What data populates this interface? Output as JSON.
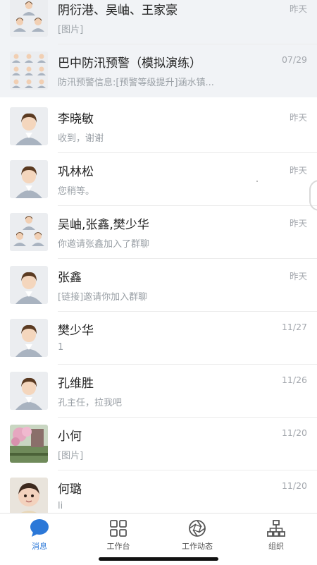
{
  "conversations": [
    {
      "name": "阴衍港、吴岫、王家豪",
      "preview": "[图片]",
      "time": "昨天",
      "avatar": "group-4",
      "pinned": true
    },
    {
      "name": "巴中防汛预警（模拟演练）",
      "preview": "防汛预警信息:[预警等级提升]涵水镇...",
      "time": "07/29",
      "avatar": "group-9",
      "pinned": true
    },
    {
      "name": "李晓敏",
      "preview": "收到，谢谢",
      "time": "昨天",
      "avatar": "person",
      "pinned": false
    },
    {
      "name": "巩林松",
      "preview": "您稍等。",
      "time": "昨天",
      "avatar": "person",
      "pinned": false
    },
    {
      "name": "吴岫,张鑫,樊少华",
      "preview": "你邀请张鑫加入了群聊",
      "time": "昨天",
      "avatar": "group-3",
      "pinned": false
    },
    {
      "name": "张鑫",
      "preview": "[链接]邀请你加入群聊",
      "time": "昨天",
      "avatar": "person",
      "pinned": false
    },
    {
      "name": "樊少华",
      "preview": "1",
      "time": "11/27",
      "avatar": "person",
      "pinned": false
    },
    {
      "name": "孔维胜",
      "preview": "孔主任，拉我吧",
      "time": "11/26",
      "avatar": "person",
      "pinned": false
    },
    {
      "name": "小何",
      "preview": "[图片]",
      "time": "11/20",
      "avatar": "photo-flowers",
      "pinned": false
    },
    {
      "name": "何璐",
      "preview": "li",
      "time": "11/20",
      "avatar": "photo-baby",
      "pinned": false
    }
  ],
  "tabbar": {
    "tabs": [
      {
        "label": "消息",
        "icon": "message-bubble-icon",
        "active": true
      },
      {
        "label": "工作台",
        "icon": "grid-icon",
        "active": false
      },
      {
        "label": "工作动态",
        "icon": "aperture-icon",
        "active": false
      },
      {
        "label": "组织",
        "icon": "org-chart-icon",
        "active": false
      }
    ]
  },
  "colors": {
    "accent": "#2b78d8",
    "pinned_bg": "#f1f3f6",
    "muted_text": "#9aa0a6"
  }
}
